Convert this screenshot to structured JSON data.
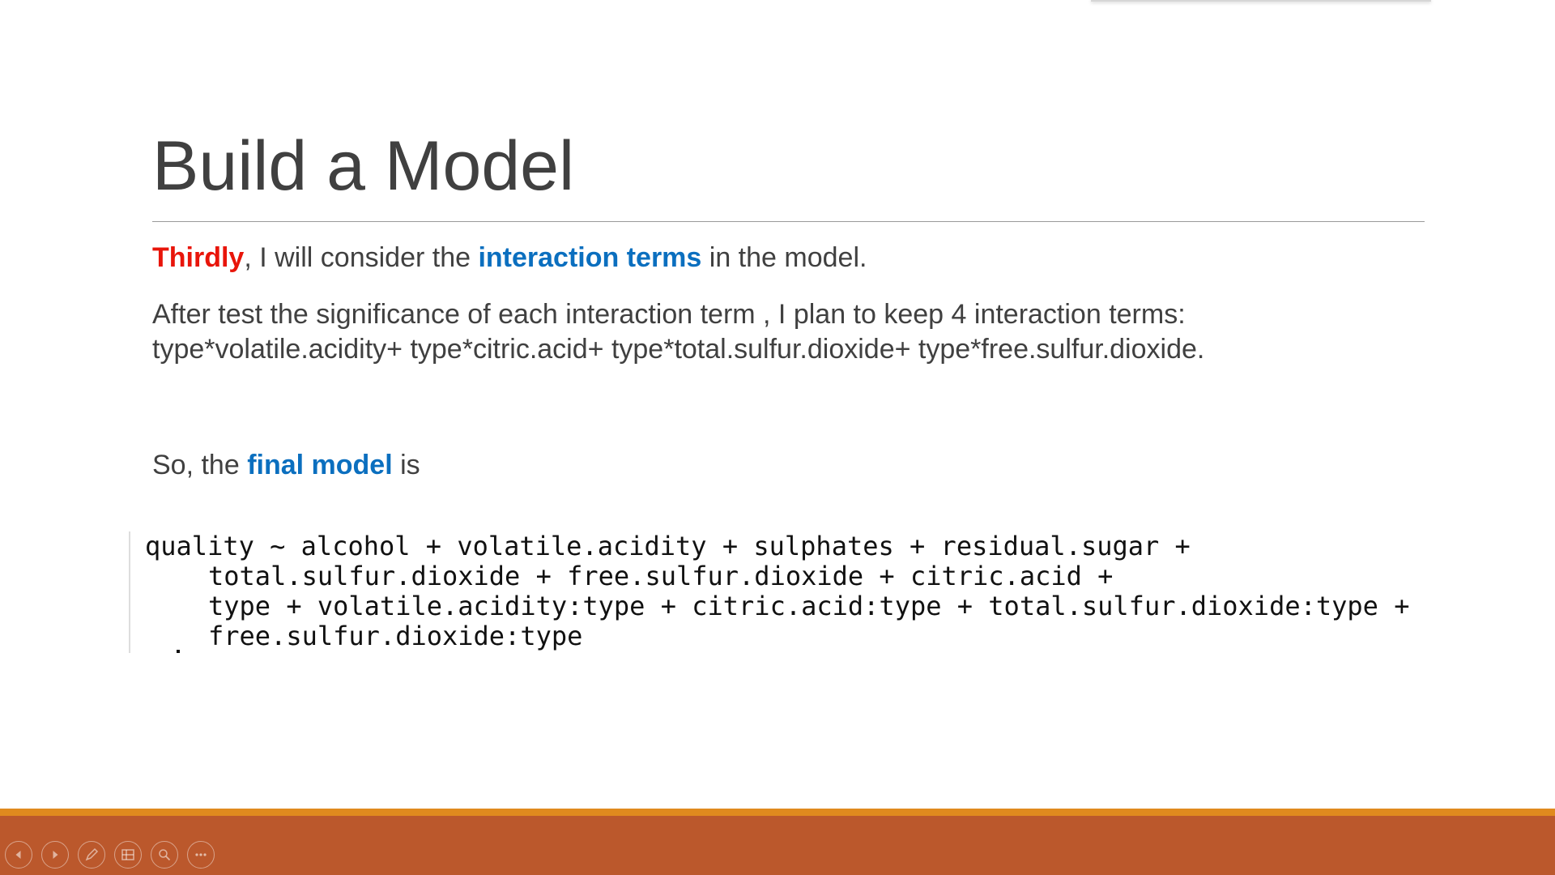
{
  "slide": {
    "title": "Build a Model",
    "para1": {
      "lead": "Thirdly",
      "text_a": ", I will consider the ",
      "highlight": "interaction terms",
      "text_b": " in the model."
    },
    "para2": {
      "line1": "After test the significance of each interaction term , I plan to keep 4 interaction terms:",
      "line2": "type*volatile.acidity+ type*citric.acid+ type*total.sulfur.dioxide+ type*free.sulfur.dioxide."
    },
    "para3": {
      "text_a": "So, the ",
      "highlight": "final model",
      "text_b": " is"
    },
    "code": {
      "line1": "quality ~ alcohol + volatile.acidity + sulphates + residual.sugar +",
      "line2": "total.sulfur.dioxide + free.sulfur.dioxide + citric.acid +",
      "line3": "type + volatile.acidity:type + citric.acid:type + total.sulfur.dioxide:type +",
      "line4": "free.sulfur.dioxide:type"
    }
  },
  "toolbar": {
    "icons": [
      "previous-icon",
      "next-icon",
      "pen-icon",
      "slides-grid-icon",
      "zoom-icon",
      "more-options-icon"
    ]
  },
  "colors": {
    "emphasis_red": "#e8150a",
    "emphasis_blue": "#0b6fbf",
    "footer_stripe": "#e08a1e",
    "footer_bar": "#bb582c"
  }
}
